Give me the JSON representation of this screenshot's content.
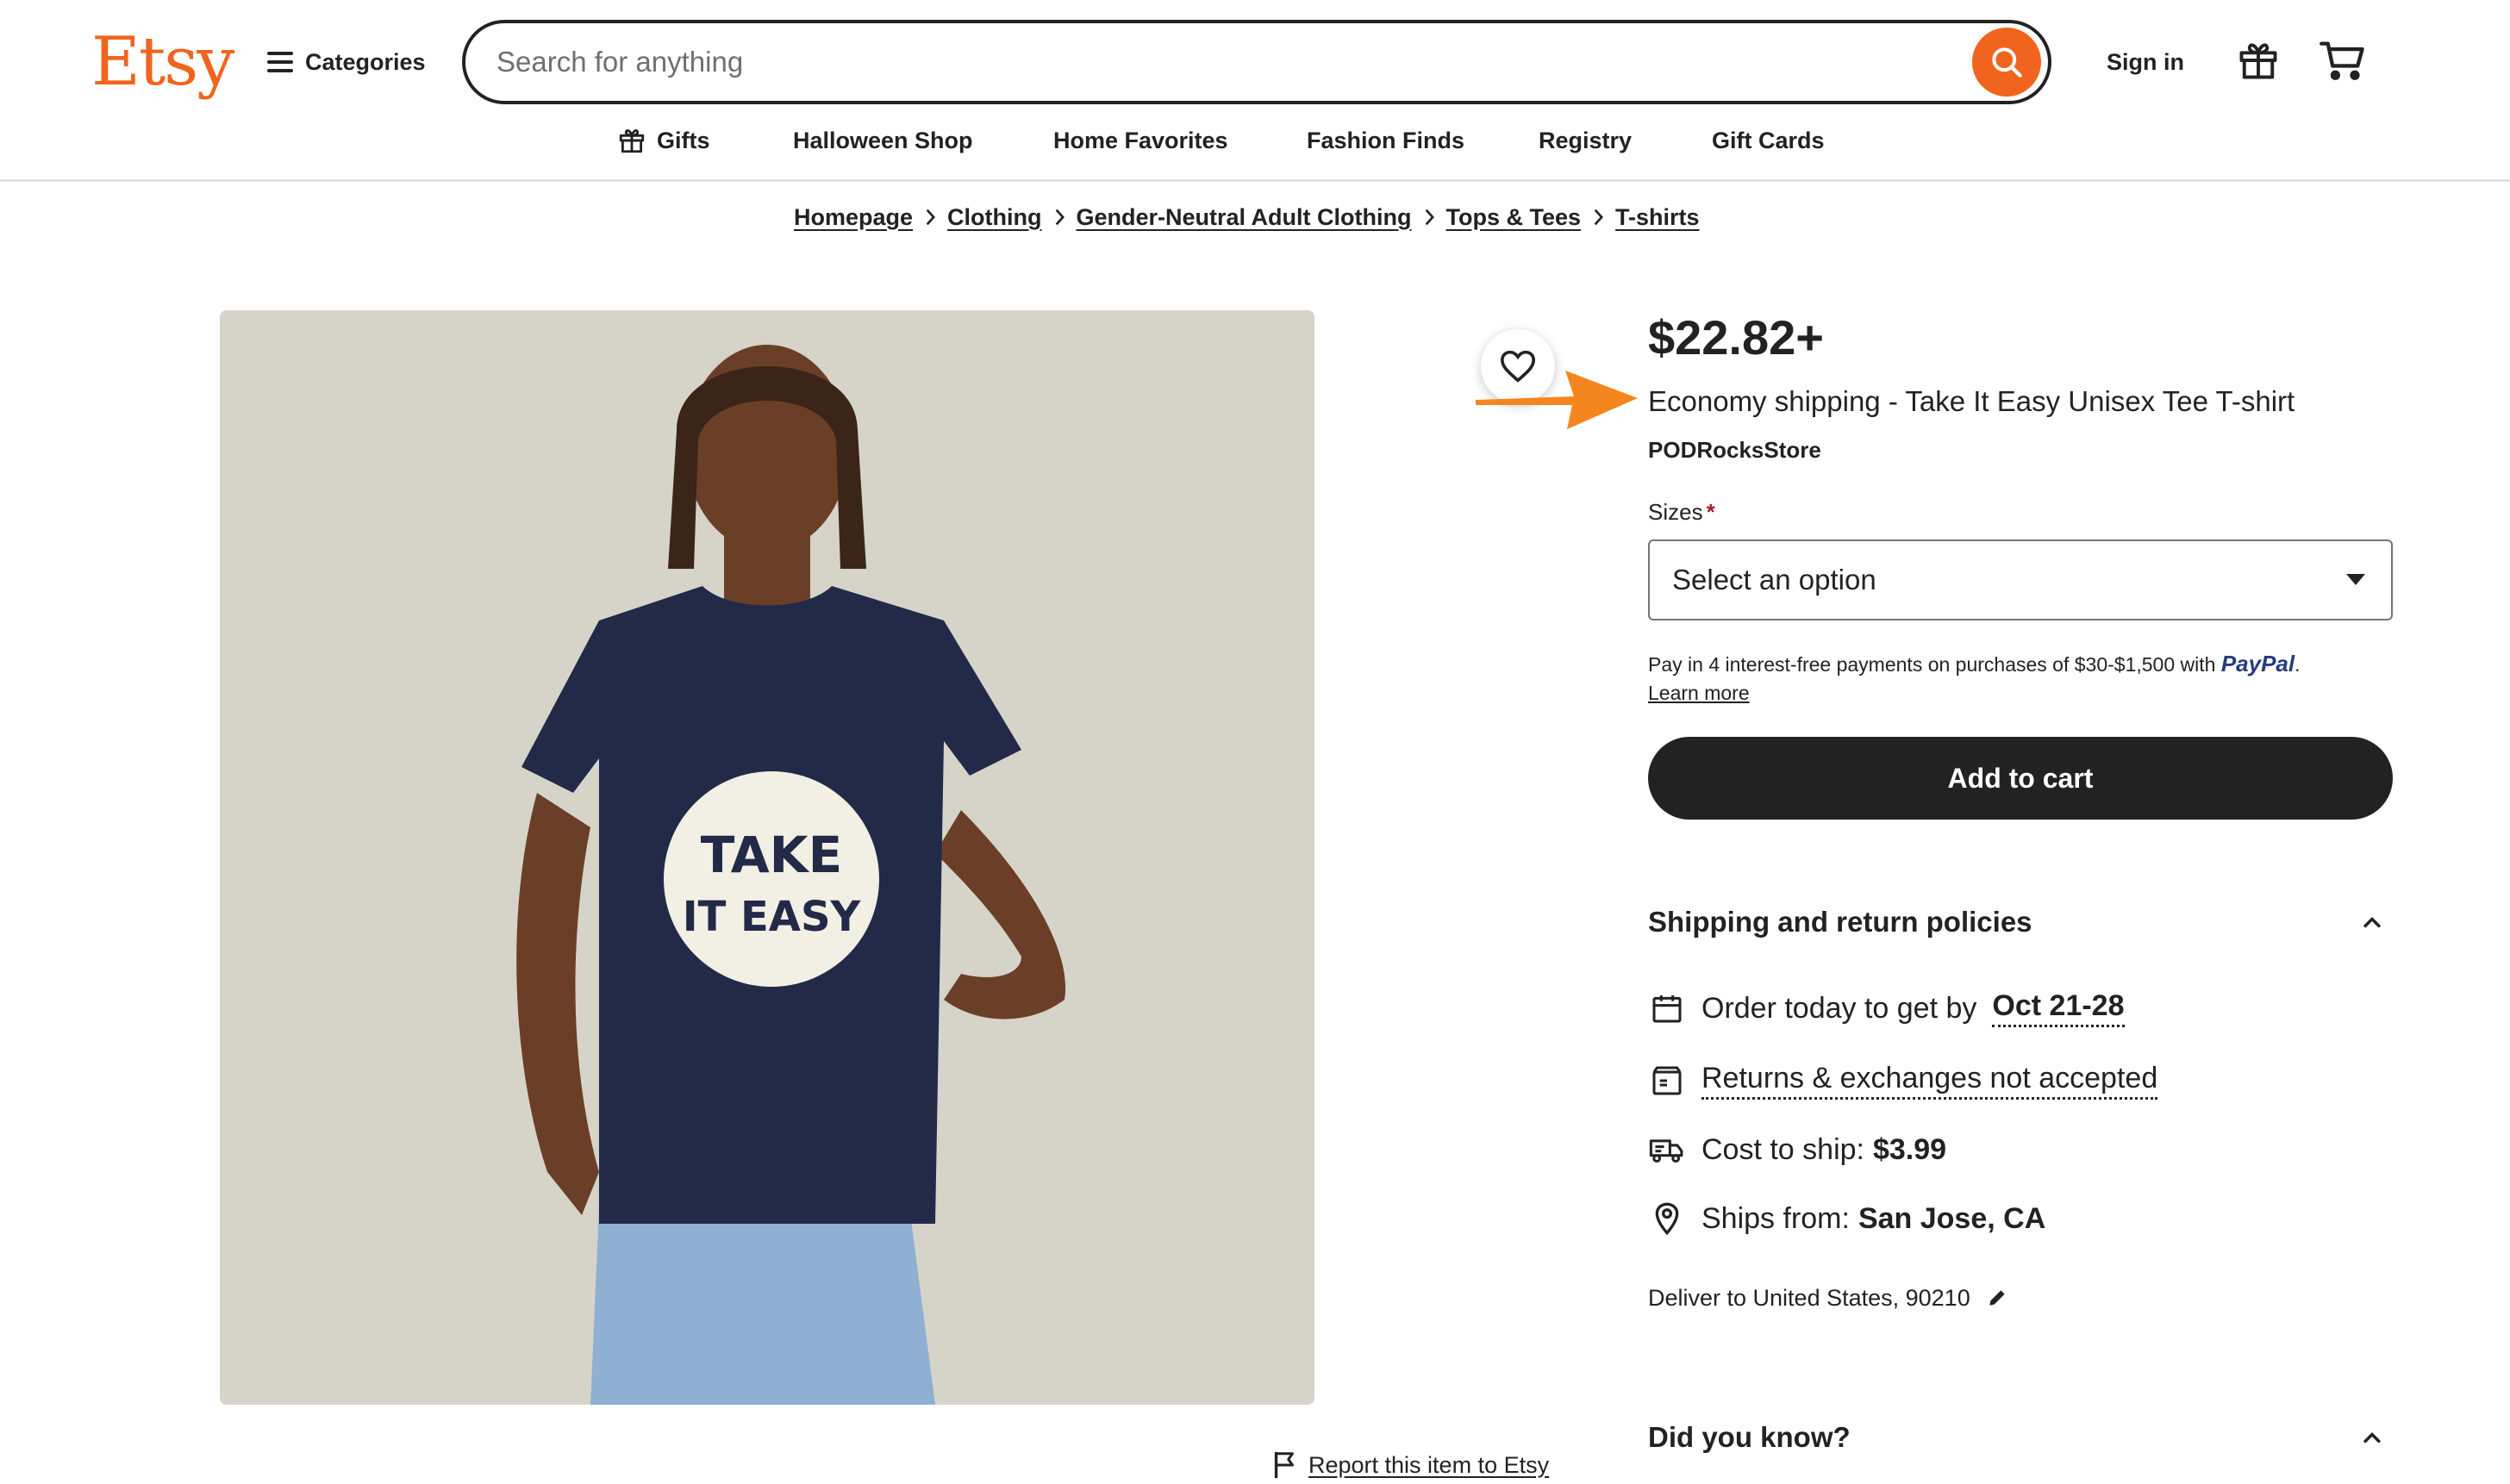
{
  "brand": {
    "logo": "Etsy",
    "accent": "#f1641e"
  },
  "header": {
    "categories_label": "Categories",
    "search_placeholder": "Search for anything",
    "signin_label": "Sign in",
    "subnav": [
      "Gifts",
      "Halloween Shop",
      "Home Favorites",
      "Fashion Finds",
      "Registry",
      "Gift Cards"
    ]
  },
  "breadcrumb": [
    "Homepage",
    "Clothing",
    "Gender-Neutral Adult Clothing",
    "Tops & Tees",
    "T-shirts"
  ],
  "product": {
    "price": "$22.82+",
    "title": "Economy shipping - Take It Easy Unisex Tee T-shirt",
    "shop": "PODRocksStore",
    "sizes_label": "Sizes",
    "select_value": "Select an option",
    "paypal_text": "Pay in 4 interest-free payments on purchases of $30-$1,500 with",
    "paypal_brand": "PayPal",
    "learn_more": "Learn more",
    "add_to_cart": "Add to cart",
    "shirt_graphic_text": "TAKE IT EASY",
    "image_colors": {
      "background": "#d6d4c9",
      "shirt": "#222a48"
    }
  },
  "shipping": {
    "section_title": "Shipping and return policies",
    "order_prefix": "Order today to get by",
    "order_date": "Oct 21-28",
    "returns": "Returns & exchanges not accepted",
    "cost_label": "Cost to ship:",
    "cost_value": "$3.99",
    "ships_from_label": "Ships from:",
    "ships_from_value": "San Jose, CA",
    "deliver_to": "Deliver to United States, 90210"
  },
  "did_you_know": {
    "title": "Did you know?"
  },
  "report": {
    "label": "Report this item to Etsy"
  },
  "icons": {
    "search": "search-icon",
    "gift": "gift-icon",
    "cart": "cart-icon",
    "heart": "heart-icon",
    "calendar": "calendar-icon",
    "returns": "returns-box-icon",
    "truck": "truck-icon",
    "pin": "location-pin-icon",
    "pencil": "pencil-icon",
    "flag": "flag-icon",
    "chevron": "chevron-up-icon"
  }
}
